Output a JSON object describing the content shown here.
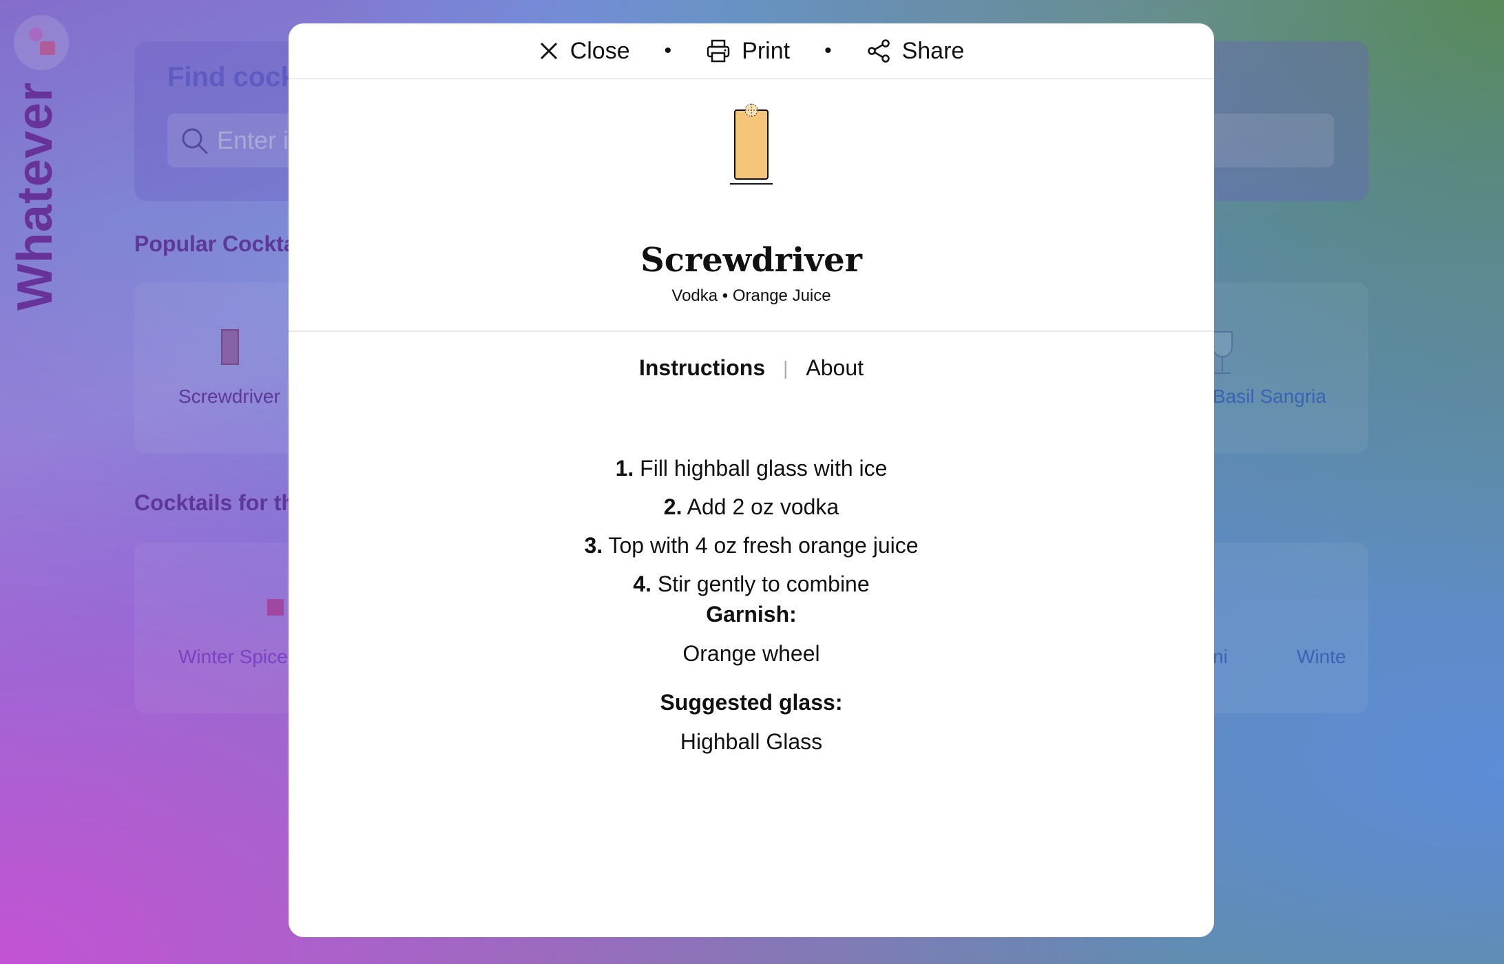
{
  "app": {
    "brand": "Whatever",
    "search_title": "Find cock",
    "search_placeholder": "Enter ir",
    "popular_title": "Popular Cockta",
    "popular_items": [
      "Screwdriver",
      "Basil Sangria"
    ],
    "seasonal_title": "Cocktails for th",
    "seasonal_items": [
      "Winter Spice",
      "ni",
      "Winte"
    ]
  },
  "modal": {
    "toolbar": {
      "close_label": "Close",
      "print_label": "Print",
      "share_label": "Share",
      "separator": "•"
    },
    "drink": {
      "name": "Screwdriver",
      "ingredients_line": "Vodka • Orange Juice",
      "glass_color": "#f5c57a"
    },
    "tabs": {
      "instructions": "Instructions",
      "separator": "|",
      "about": "About"
    },
    "steps": [
      {
        "num": "1.",
        "text": "Fill highball glass with ice"
      },
      {
        "num": "2.",
        "text": "Add 2 oz vodka"
      },
      {
        "num": "3.",
        "text": "Top with 4 oz fresh orange juice"
      },
      {
        "num": "4.",
        "text": "Stir gently to combine"
      }
    ],
    "garnish_label": "Garnish:",
    "garnish_value": "Orange wheel",
    "glass_label": "Suggested glass:",
    "glass_value": "Highball Glass"
  }
}
